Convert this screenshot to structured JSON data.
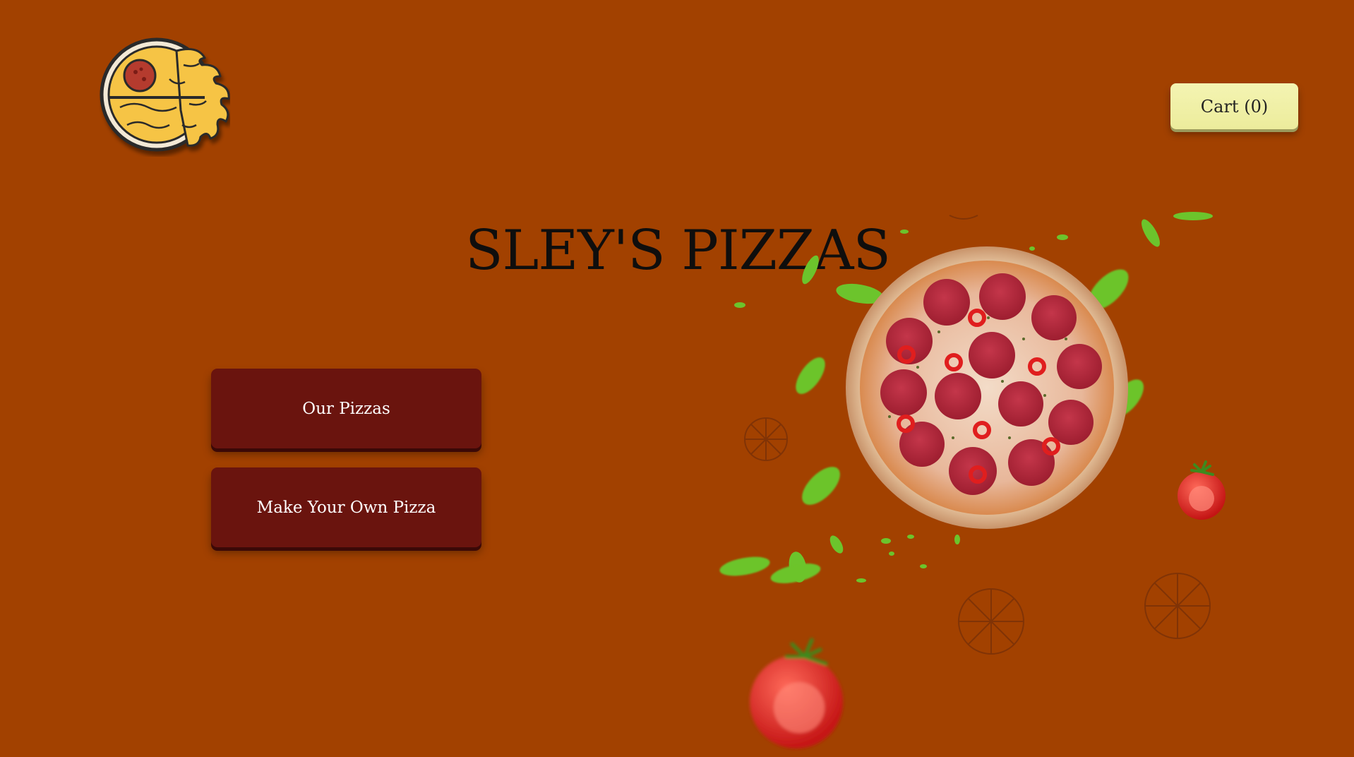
{
  "header": {
    "logo_icon": "pizza-logo-icon",
    "cart_label": "Cart (0)"
  },
  "hero": {
    "title": "SLEY'S PIZZAS"
  },
  "menu": {
    "our_pizzas_label": "Our Pizzas",
    "make_your_own_label": "Make Your Own Pizza"
  },
  "colors": {
    "background": "#a24100",
    "button": "#6a140e",
    "cart_button": "#f0f0a8"
  }
}
